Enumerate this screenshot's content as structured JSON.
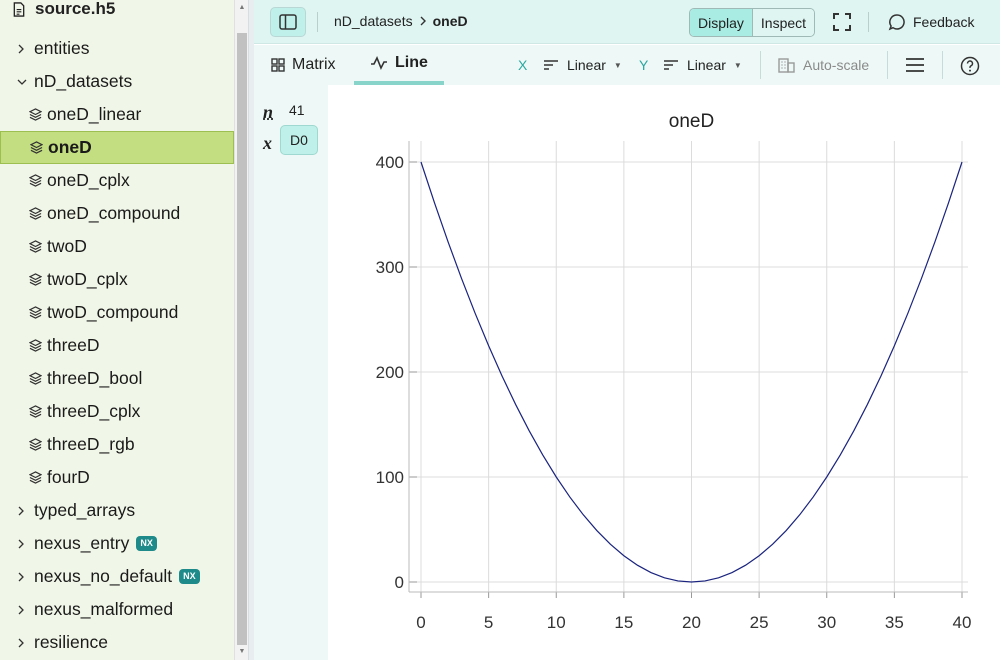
{
  "sidebar": {
    "file_name": "source.h5",
    "items": [
      {
        "label": "entities",
        "type": "group",
        "expanded": false,
        "badge": ""
      },
      {
        "label": "nD_datasets",
        "type": "group",
        "expanded": true,
        "badge": ""
      },
      {
        "label": "oneD_linear",
        "type": "dataset",
        "selected": false,
        "badge": ""
      },
      {
        "label": "oneD",
        "type": "dataset",
        "selected": true,
        "badge": ""
      },
      {
        "label": "oneD_cplx",
        "type": "dataset",
        "selected": false,
        "badge": ""
      },
      {
        "label": "oneD_compound",
        "type": "dataset",
        "selected": false,
        "badge": ""
      },
      {
        "label": "twoD",
        "type": "dataset",
        "selected": false,
        "badge": ""
      },
      {
        "label": "twoD_cplx",
        "type": "dataset",
        "selected": false,
        "badge": ""
      },
      {
        "label": "twoD_compound",
        "type": "dataset",
        "selected": false,
        "badge": ""
      },
      {
        "label": "threeD",
        "type": "dataset",
        "selected": false,
        "badge": ""
      },
      {
        "label": "threeD_bool",
        "type": "dataset",
        "selected": false,
        "badge": ""
      },
      {
        "label": "threeD_cplx",
        "type": "dataset",
        "selected": false,
        "badge": ""
      },
      {
        "label": "threeD_rgb",
        "type": "dataset",
        "selected": false,
        "badge": ""
      },
      {
        "label": "fourD",
        "type": "dataset",
        "selected": false,
        "badge": ""
      },
      {
        "label": "typed_arrays",
        "type": "group",
        "expanded": false,
        "badge": ""
      },
      {
        "label": "nexus_entry",
        "type": "group",
        "expanded": false,
        "badge": "NX"
      },
      {
        "label": "nexus_no_default",
        "type": "group",
        "expanded": false,
        "badge": "NX"
      },
      {
        "label": "nexus_malformed",
        "type": "group",
        "expanded": false,
        "badge": ""
      },
      {
        "label": "resilience",
        "type": "group",
        "expanded": false,
        "badge": ""
      }
    ]
  },
  "topbar": {
    "breadcrumb_parent": "nD_datasets",
    "breadcrumb_current": "oneD",
    "display_label": "Display",
    "inspect_label": "Inspect",
    "feedback_label": "Feedback"
  },
  "toolbar": {
    "tab_matrix": "Matrix",
    "tab_line": "Line",
    "x_axis_label": "X",
    "x_scale": "Linear",
    "y_axis_label": "Y",
    "y_scale": "Linear",
    "autoscale_label": "Auto-scale"
  },
  "dims": {
    "n_label": "n",
    "n_value": "41",
    "x_label": "x",
    "x_dim": "D0"
  },
  "colors": {
    "line": "#1a237e",
    "selected_bg": "#c3de81",
    "accent": "#88d4ca"
  },
  "chart_data": {
    "type": "line",
    "title": "oneD",
    "xlabel": "",
    "ylabel": "",
    "x_ticks": [
      "0",
      "5",
      "10",
      "15",
      "20",
      "25",
      "30",
      "35",
      "40"
    ],
    "y_ticks": [
      "0",
      "100",
      "200",
      "300",
      "400"
    ],
    "xlim": [
      0,
      40
    ],
    "ylim": [
      0,
      400
    ],
    "grid": true,
    "series": [
      {
        "x": [
          0,
          1,
          2,
          3,
          4,
          5,
          6,
          7,
          8,
          9,
          10,
          11,
          12,
          13,
          14,
          15,
          16,
          17,
          18,
          19,
          20,
          21,
          22,
          23,
          24,
          25,
          26,
          27,
          28,
          29,
          30,
          31,
          32,
          33,
          34,
          35,
          36,
          37,
          38,
          39,
          40
        ],
        "values": [
          400,
          361,
          324,
          289,
          256,
          225,
          196,
          169,
          144,
          121,
          100,
          81,
          64,
          49,
          36,
          25,
          16,
          9,
          4,
          1,
          0,
          1,
          4,
          9,
          16,
          25,
          36,
          49,
          64,
          81,
          100,
          121,
          144,
          169,
          196,
          225,
          256,
          289,
          324,
          361,
          400
        ]
      }
    ]
  }
}
